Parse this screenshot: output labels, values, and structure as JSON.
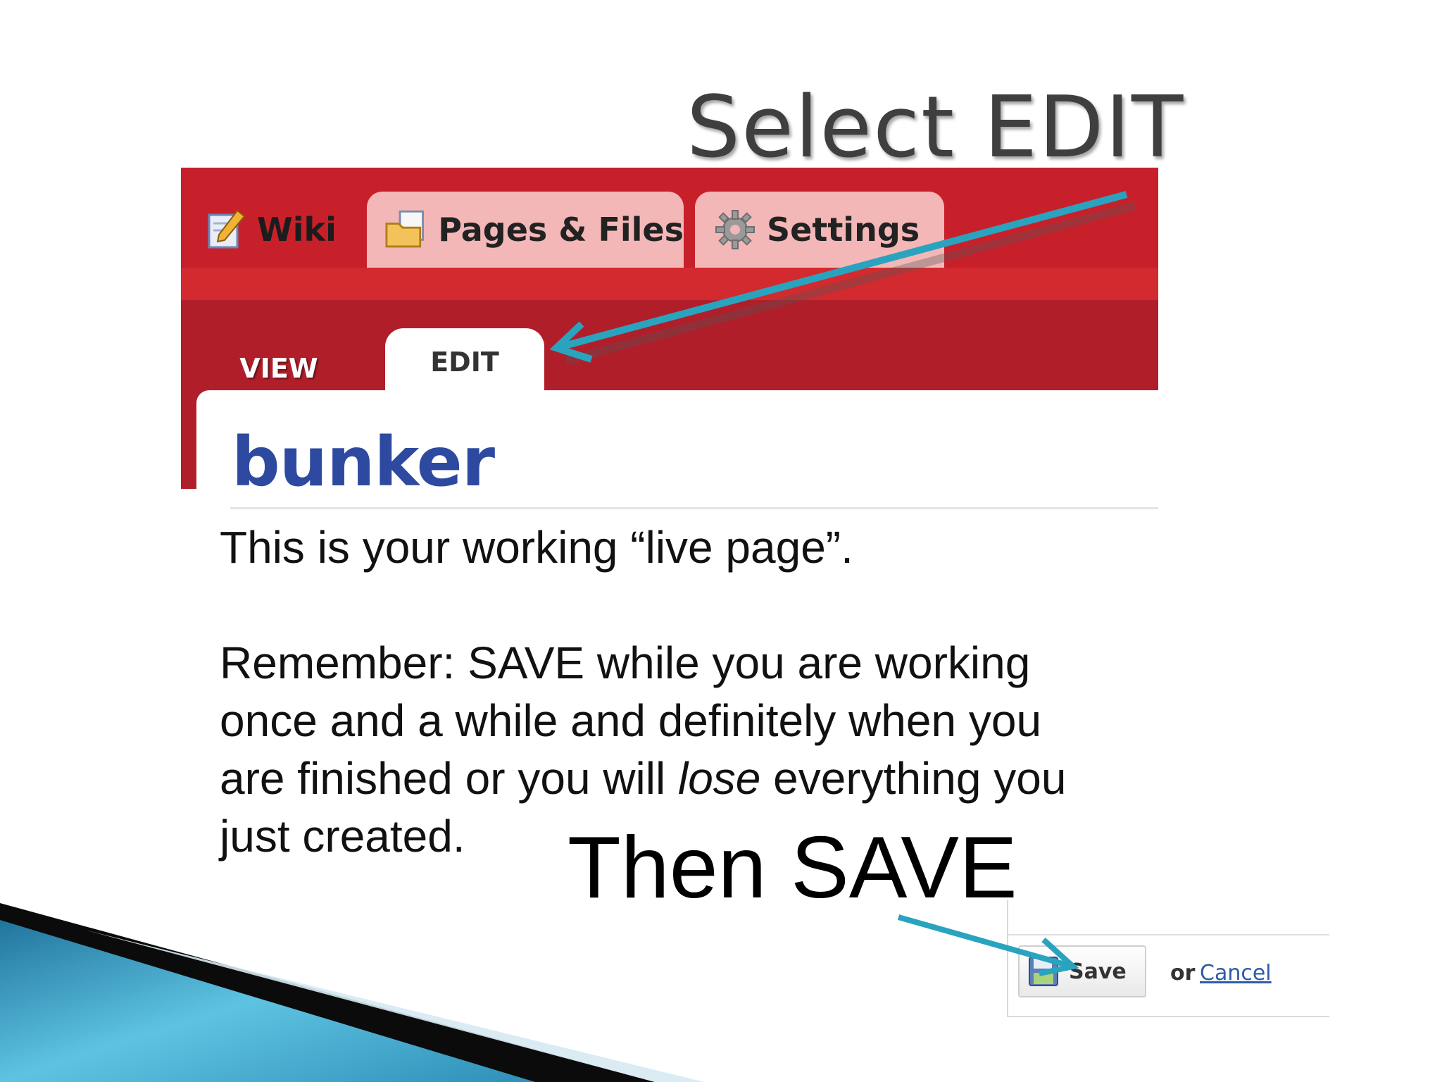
{
  "slide": {
    "title": "Select EDIT",
    "intro": "This is your working “live page”.",
    "reminder_lines": [
      {
        "before": "Remember:  SAVE while you are working",
        "em": "",
        "after": ""
      },
      {
        "before": "once and a while and definitely when you",
        "em": "",
        "after": ""
      },
      {
        "before": "are finished or you will ",
        "em": "lose",
        "after": " everything you"
      },
      {
        "before": "just created.",
        "em": "",
        "after": ""
      }
    ],
    "then_save": "Then SAVE"
  },
  "wiki": {
    "main_tabs": [
      {
        "label": "Wiki",
        "icon": "pencil-page-icon"
      },
      {
        "label": "Pages & Files",
        "icon": "folder-page-icon"
      },
      {
        "label": "Settings",
        "icon": "gear-icon"
      }
    ],
    "sub_tabs": {
      "view": "VIEW",
      "edit": "EDIT"
    },
    "page_title": "bunker"
  },
  "save_bar": {
    "save_label": "Save",
    "or_label": "or",
    "cancel_label": "Cancel"
  },
  "colors": {
    "tab_bar_red": "#c8202b",
    "inactive_tab_pink": "#f4b7b7",
    "heading_blue": "#2e4aa0",
    "arrow_teal": "#2aa3bf",
    "decor_blue": "#3aa6cf"
  }
}
